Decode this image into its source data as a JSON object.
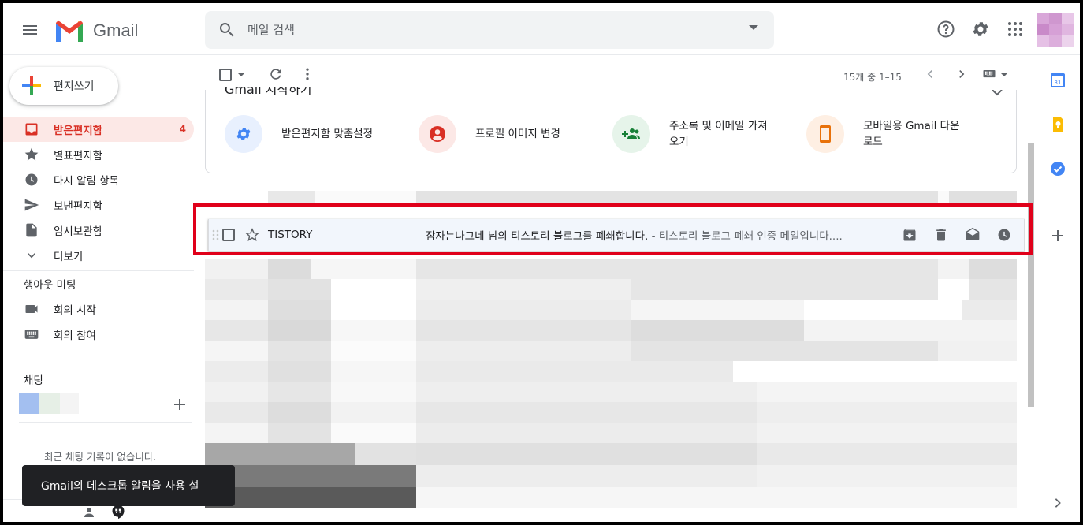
{
  "app": {
    "logo_text": "Gmail"
  },
  "search": {
    "placeholder": "메일 검색"
  },
  "compose": {
    "label": "편지쓰기"
  },
  "nav": [
    {
      "label": "받은편지함",
      "icon": "inbox-icon",
      "count": "4",
      "active": true
    },
    {
      "label": "별표편지함",
      "icon": "star-icon"
    },
    {
      "label": "다시 알림 항목",
      "icon": "clock-icon"
    },
    {
      "label": "보낸편지함",
      "icon": "send-icon"
    },
    {
      "label": "임시보관함",
      "icon": "draft-icon"
    },
    {
      "label": "더보기",
      "icon": "chevron-down-icon"
    }
  ],
  "meet": {
    "title": "행아웃 미팅",
    "items": [
      {
        "label": "회의 시작",
        "icon": "video-icon"
      },
      {
        "label": "회의 참여",
        "icon": "keyboard-icon"
      }
    ]
  },
  "chat": {
    "title": "채팅",
    "empty": "최근 채팅 기록이 없습니다."
  },
  "toolbar": {
    "pager": "15개 중 1–15"
  },
  "getting_started": {
    "title": "Gmail 시작하기",
    "items": [
      {
        "label": "받은편지함 맞춤설정",
        "icon": "gear-icon",
        "color": "#4285f4",
        "bg": "#e8f0fe"
      },
      {
        "label": "프로필 이미지 변경",
        "icon": "account-icon",
        "color": "#d93025",
        "bg": "#fce8e6"
      },
      {
        "label": "주소록 및 이메일 가져오기",
        "icon": "add-group-icon",
        "color": "#188038",
        "bg": "#e6f4ea"
      },
      {
        "label": "모바일용 Gmail 다운로드",
        "icon": "phone-icon",
        "color": "#e8710a",
        "bg": "#feefe3"
      }
    ]
  },
  "mail": {
    "sender": "TISTORY",
    "subject": "잠자는나그네 님의 티스토리 블로그를 폐쇄합니다.",
    "snippet": " - 티스토리 블로그 폐쇄 인증 메일입니다...."
  },
  "toast": {
    "text": "Gmail의 데스크톱 알림을 사용 설"
  },
  "colors": {
    "accent_red": "#d93025",
    "highlight_box": "#e0001a"
  }
}
